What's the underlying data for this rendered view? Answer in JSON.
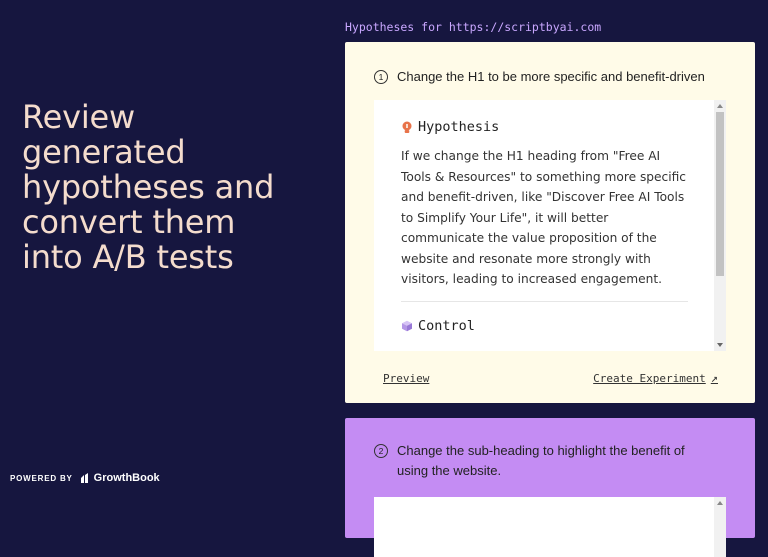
{
  "hero": {
    "line1": "Review",
    "line2": "generated",
    "line3": "hypotheses and",
    "line4": "convert them",
    "line5": "into A/B tests"
  },
  "powered": {
    "label": "POWERED BY",
    "brand": "GrowthBook"
  },
  "hypotheses_header": "Hypotheses for https://scriptbyai.com",
  "cards": [
    {
      "number": "1",
      "title": "Change the H1 to be more specific and benefit-driven",
      "hypothesis_label": "Hypothesis",
      "hypothesis_icon": "lightbulb-icon",
      "hypothesis_text": "If we change the H1 heading from \"Free AI Tools & Resources\" to something more specific and benefit-driven, like \"Discover Free AI Tools to Simplify Your Life\", it will better communicate the value proposition of the website and resonate more strongly with visitors, leading to increased engagement.",
      "control_label": "Control",
      "control_icon": "cube-icon",
      "preview_label": "Preview",
      "create_label": "Create Experiment",
      "color": "#fffbe8"
    },
    {
      "number": "2",
      "title": "Change the sub-heading to highlight the benefit of using the website.",
      "color": "#c48cf3"
    }
  ],
  "colors": {
    "background": "#16163f",
    "hero_text": "#f4dccd",
    "header_text": "#c9a7ff",
    "bulb": "#e8734a",
    "cube": "#b496e6"
  }
}
